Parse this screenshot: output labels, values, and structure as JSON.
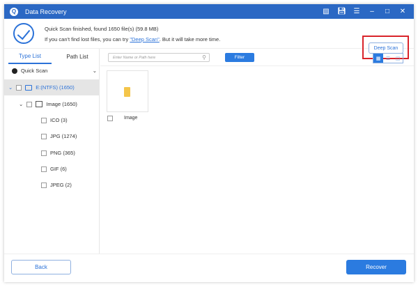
{
  "app": {
    "title": "Data Recovery",
    "logo": "Q"
  },
  "window_controls": [
    "feedback-icon",
    "save-icon",
    "menu-icon",
    "minimize-icon",
    "maximize-icon",
    "close-icon"
  ],
  "header": {
    "status": "Quick Scan finished, found 1650 file(s) (59.8 MB)",
    "hint_pre": "If you can't find lost files, you can try ",
    "hint_link": "\"Deep Scan\"",
    "hint_post": ". But it will take more time.",
    "deep_scan_label": "Deep Scan"
  },
  "sidebar": {
    "tabs": [
      "Type List",
      "Path List"
    ],
    "scan_mode": "Quick Scan",
    "drive": "E:(NTFS) (1650)",
    "category": "Image (1650)",
    "types": [
      "ICO (3)",
      "JPG (1274)",
      "PNG (365)",
      "GIF (6)",
      "JPEG (2)"
    ]
  },
  "toolbar": {
    "search_placeholder": "Enter Name or Path here",
    "filter_label": "Filter"
  },
  "files": [
    {
      "name": "Image"
    }
  ],
  "footer": {
    "back_label": "Back",
    "recover_label": "Recover"
  },
  "colors": {
    "accent": "#2b68c4",
    "button": "#2b7be0",
    "highlight": "#d9232a"
  }
}
